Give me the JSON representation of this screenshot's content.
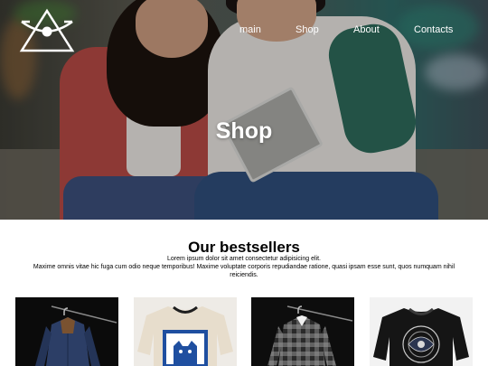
{
  "nav": {
    "items": [
      {
        "label": "main"
      },
      {
        "label": "Shop"
      },
      {
        "label": "About"
      },
      {
        "label": "Contacts"
      }
    ]
  },
  "hero": {
    "title": "Shop"
  },
  "bestsellers": {
    "title": "Our bestsellers",
    "subtitle": "Lorem ipsum dolor sit amet consectetur adipisicing elit.",
    "description": "Maxime omnis vitae hic fuga cum odio neque temporibus! Maxime voluptate corporis repudiandae ratione, quasi ipsam esse sunt, quos numquam nihil reiciendis."
  },
  "products": [
    {
      "icon": "denim-jacket-image"
    },
    {
      "icon": "cat-sweatshirt-image"
    },
    {
      "icon": "plaid-shirt-image"
    },
    {
      "icon": "black-graphic-sweatshirt-image"
    }
  ],
  "colors": {
    "text_on_hero": "#ffffff",
    "page_background": "#ffffff"
  }
}
